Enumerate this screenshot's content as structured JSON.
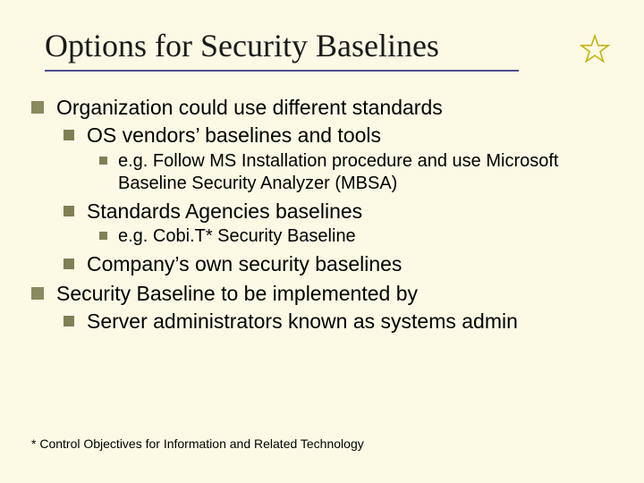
{
  "title": "Options for Security Baselines",
  "b1": "Organization could use different standards",
  "b1_1": "OS vendors’ baselines and tools",
  "b1_1_1": "e.g. Follow MS Installation procedure and use Microsoft Baseline Security Analyzer (MBSA)",
  "b1_2": "Standards Agencies baselines",
  "b1_2_1": "e.g. Cobi.T* Security Baseline",
  "b1_3": "Company’s own security baselines",
  "b2": "Security Baseline to be implemented by",
  "b2_1": "Server administrators known as systems admin",
  "footnote": "* Control Objectives for Information and Related Technology"
}
